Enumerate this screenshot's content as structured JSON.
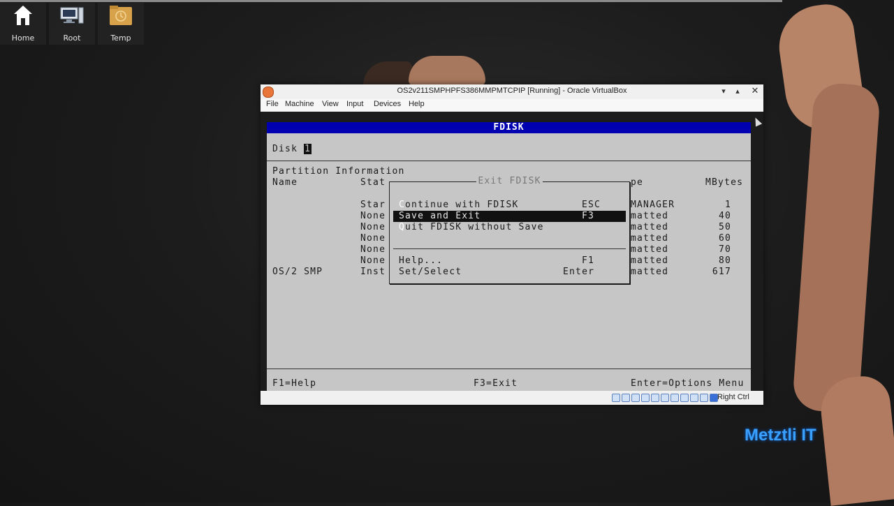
{
  "desktop": {
    "icons": [
      {
        "label": "Home",
        "icon": "home-icon"
      },
      {
        "label": "Root",
        "icon": "computer-icon"
      },
      {
        "label": "Temp",
        "icon": "folder-clock-icon"
      }
    ],
    "watermark": "Metztli IT"
  },
  "vbox": {
    "title": "OS2v211SMPHPFS386MMPMTCPIP [Running] - Oracle VirtualBox",
    "window_buttons": {
      "minimize": "▾",
      "maximize": "▴",
      "close": "✕"
    },
    "menu": [
      "File",
      "Machine",
      "View",
      "Input",
      "Devices",
      "Help"
    ],
    "status_host_key": "Right Ctrl"
  },
  "fdisk": {
    "title": "FDISK",
    "disk_label": "Disk ",
    "disk_number": "1",
    "partition_info": "Partition Information",
    "headers": {
      "name": "Name",
      "status": "Stat",
      "type": "pe",
      "mbytes": "MBytes"
    },
    "rows": [
      {
        "name": "",
        "status": "Star",
        "type": "MANAGER",
        "mbytes": "1"
      },
      {
        "name": "",
        "status": "None",
        "type": "matted",
        "mbytes": "40"
      },
      {
        "name": "",
        "status": "None",
        "type": "matted",
        "mbytes": "50"
      },
      {
        "name": "",
        "status": "None",
        "type": "matted",
        "mbytes": "60"
      },
      {
        "name": "",
        "status": "None",
        "type": "matted",
        "mbytes": "70"
      },
      {
        "name": "",
        "status": "None",
        "type": "matted",
        "mbytes": "80"
      },
      {
        "name": "OS/2 SMP",
        "status": "Inst",
        "type": "matted",
        "mbytes": "617"
      }
    ],
    "footer": {
      "left": "F1=Help",
      "center": "F3=Exit",
      "right": "Enter=Options Menu"
    },
    "dialog": {
      "title": "Exit FDISK",
      "options": [
        {
          "hot": "C",
          "rest": "ontinue with FDISK",
          "key": "ESC"
        },
        {
          "hot": "",
          "rest": "Save and Exit",
          "key": "F3"
        },
        {
          "hot": "Q",
          "rest": "uit FDISK without Save",
          "key": ""
        }
      ],
      "help_options": [
        {
          "label": "Help...",
          "key": "F1"
        },
        {
          "label": "Set/Select",
          "key": "Enter"
        }
      ],
      "selected_index": 1
    }
  }
}
